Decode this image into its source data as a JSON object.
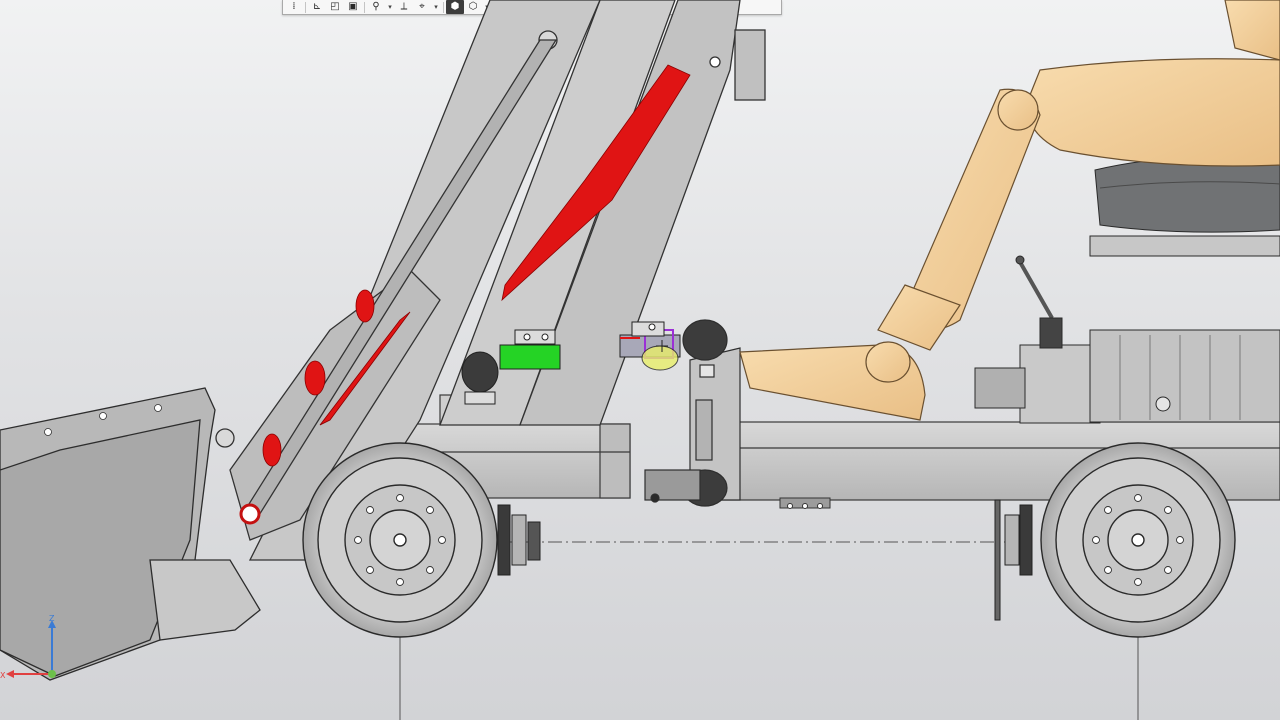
{
  "toolbar": {
    "buttons": [
      {
        "name": "grip-handle",
        "glyph": "⁞",
        "dark": false,
        "drop": false
      },
      {
        "name": "sketch-plane-button",
        "glyph": "⊾",
        "dark": false,
        "drop": false
      },
      {
        "name": "edit-sketch-button",
        "glyph": "◰",
        "dark": false,
        "drop": false
      },
      {
        "name": "part-properties-button",
        "glyph": "▣",
        "dark": false,
        "drop": false
      },
      {
        "name": "zoom-tools-button",
        "glyph": "⚲",
        "dark": false,
        "drop": true
      },
      {
        "name": "measure-tools-button",
        "glyph": "⟂",
        "dark": false,
        "drop": false
      },
      {
        "name": "sectioning-button",
        "glyph": "⌖",
        "dark": false,
        "drop": true
      },
      {
        "name": "shaded-view-button",
        "glyph": "⬢",
        "dark": true,
        "drop": false
      },
      {
        "name": "view-orientation-button",
        "glyph": "⬡",
        "dark": false,
        "drop": true
      },
      {
        "name": "visibility-button",
        "glyph": "◉",
        "dark": false,
        "drop": true
      },
      {
        "name": "render-mode-button",
        "glyph": "◙",
        "dark": true,
        "drop": true
      },
      {
        "name": "cross-section-button",
        "glyph": "⧄",
        "dark": true,
        "drop": false
      },
      {
        "name": "copy-view-button",
        "glyph": "⧉",
        "dark": false,
        "drop": false
      },
      {
        "name": "snapshot-button",
        "glyph": "⎘",
        "dark": false,
        "drop": false
      },
      {
        "name": "filter-button",
        "glyph": "▼",
        "dark": true,
        "drop": true
      },
      {
        "name": "selection-tree-button",
        "glyph": "⊟",
        "dark": false,
        "drop": false
      },
      {
        "name": "pin-button",
        "glyph": "⚑",
        "dark": false,
        "drop": false,
        "disabled": true
      }
    ]
  },
  "triad": {
    "z_label": "Z",
    "x_label": "X",
    "colors": {
      "z": "#3a7bd5",
      "x": "#e04040",
      "origin": "#6cc04a"
    }
  },
  "colors": {
    "frame": "#c9c9c9",
    "frame_stroke": "#3a3a3a",
    "red_highlight": "#e01414",
    "green_highlight": "#25d325",
    "purple_highlight": "#9b30d6",
    "yellow_highlight": "#e9ef6a",
    "mannequin": "#f4cf9a",
    "seat": "#707274",
    "wheel": "#cacaca"
  }
}
